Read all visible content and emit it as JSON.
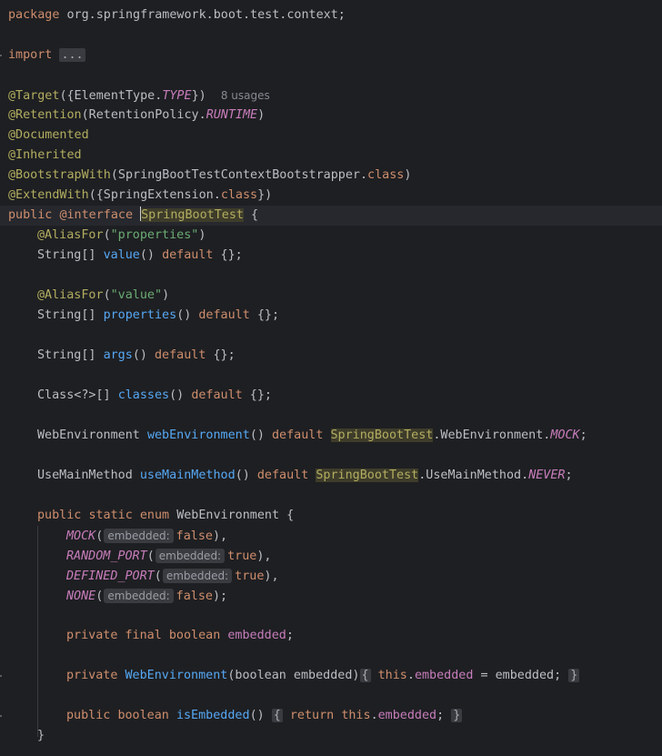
{
  "code": {
    "package_kw": "package",
    "package_name": "org.springframework.boot.test.context;",
    "import_kw": "import",
    "import_fold": "...",
    "ann_target": "@Target",
    "target_args_open": "({ElementType.",
    "target_const": "TYPE",
    "target_args_close": "})",
    "usages_hint": "8 usages",
    "ann_retention": "@Retention",
    "retention_open": "(RetentionPolicy.",
    "retention_const": "RUNTIME",
    "retention_close": ")",
    "ann_documented": "@Documented",
    "ann_inherited": "@Inherited",
    "ann_bootstrap": "@BootstrapWith",
    "bootstrap_open": "(SpringBootTestContextBootstrapper.",
    "class_kw": "class",
    "close_paren": ")",
    "ann_extend": "@ExtendWith",
    "extend_open": "({SpringExtension.",
    "extend_close": "})",
    "public_kw": "public",
    "interface_kw": "@interface",
    "type_name": "SpringBootTest",
    "open_brace": " {",
    "ann_aliasfor": "@AliasFor",
    "alias_properties": "\"properties\"",
    "alias_value": "\"value\"",
    "string_arr": "String[] ",
    "value_fn": "value",
    "properties_fn": "properties",
    "args_fn": "args",
    "classes_type": "Class<?>[] ",
    "classes_fn": "classes",
    "parens": "()",
    "default_kw": "default",
    "empty_default": " {};",
    "webenv_type": "WebEnvironment ",
    "webenv_fn": "webEnvironment",
    "webenv_ref": ".WebEnvironment.",
    "mock_const": "MOCK",
    "usemain_type": "UseMainMethod ",
    "usemain_fn": "useMainMethod",
    "usemain_ref": ".UseMainMethod.",
    "never_const": "NEVER",
    "semicolon": ";",
    "static_kw": "static",
    "enum_kw": "enum",
    "enum_name": "WebEnvironment",
    "enum_mock": "MOCK",
    "enum_random": "RANDOM_PORT",
    "enum_defined": "DEFINED_PORT",
    "enum_none": "NONE",
    "embedded_hint": "embedded:",
    "false_kw": "false",
    "true_kw": "true",
    "comma_close": "),",
    "semi_close": ");",
    "private_kw": "private",
    "final_kw": "final",
    "boolean_kw": "boolean",
    "embedded_field": "embedded",
    "ctor_name": "WebEnvironment",
    "ctor_param": "(boolean embedded)",
    "this_kw": "this",
    "assign_rest": " = embedded;",
    "is_embedded_fn": "isEmbedded",
    "return_kw": "return",
    "fold_open": "{",
    "fold_close": "}",
    "inner_close": "}"
  }
}
